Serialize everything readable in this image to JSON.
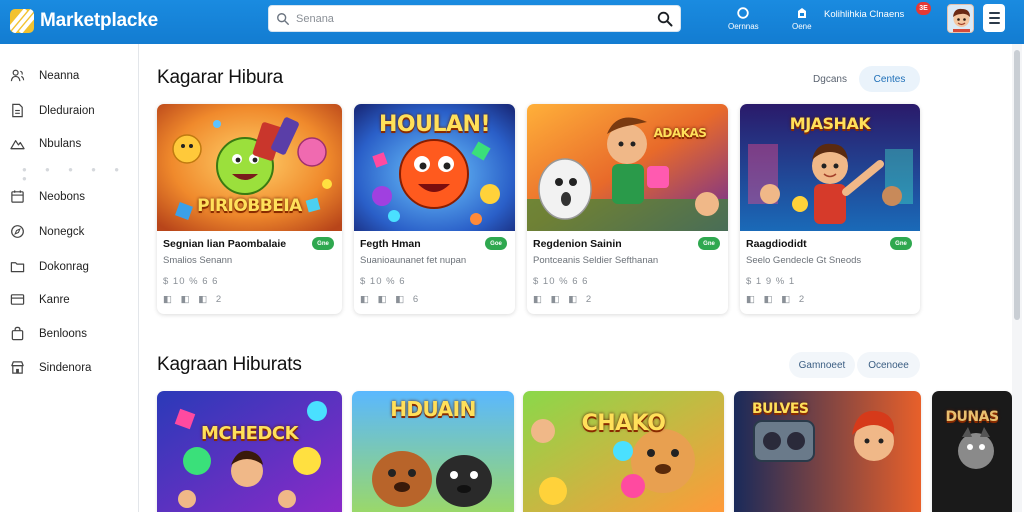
{
  "header": {
    "brand": "Marketplacke",
    "search": {
      "placeholder": "Senana",
      "value": ""
    },
    "actions": [
      {
        "label": "Oernnas",
        "icon": "circle-icon"
      },
      {
        "label": "Oene",
        "icon": "bag-icon"
      }
    ],
    "notification_text": "Kolihlihkia Clnaens",
    "notification_badge": "3E"
  },
  "sidebar": {
    "items": [
      {
        "label": "Neanna",
        "icon": "people-icon"
      },
      {
        "label": "Dleduraion",
        "icon": "document-icon"
      },
      {
        "label": "Nbulans",
        "icon": "mountain-icon"
      },
      {
        "label": "Neobons",
        "icon": "calendar-icon"
      },
      {
        "label": "Nonegck",
        "icon": "compass-icon"
      },
      {
        "label": "Dokonrag",
        "icon": "folder-icon"
      },
      {
        "label": "Kanre",
        "icon": "card-icon"
      },
      {
        "label": "Benloons",
        "icon": "bag-icon"
      },
      {
        "label": "Sindenora",
        "icon": "store-icon"
      }
    ]
  },
  "sections": [
    {
      "title": "Kagarar Hibura",
      "tabs": [
        {
          "label": "Dgcans",
          "active": false
        },
        {
          "label": "Centes",
          "active": true
        }
      ],
      "cards": [
        {
          "thumb_title": "PIRIOBBEIA",
          "name": "Segnian lian Paombalaie",
          "tag": "Gne",
          "subtitle": "Smalios Senann",
          "price": "$ 10 % 6 6",
          "icons": "◧ ◧ ◧ 2"
        },
        {
          "thumb_title": "HOULAN!",
          "name": "Fegth Hman",
          "tag": "Goe",
          "subtitle": "Suanioaunanet fet nupan",
          "price": "$ 10 % 6",
          "icons": "◧ ◧ ◧ 6"
        },
        {
          "thumb_title": "ADAKAS",
          "name": "Regdenion Sainin",
          "tag": "Gne",
          "subtitle": "Pontceanis Seldier Sefthanan",
          "price": "$ 10 % 6 6",
          "icons": "◧ ◧ ◧ 2"
        },
        {
          "thumb_title": "MJASHAK",
          "name": "Raagdiodidt",
          "tag": "Gne",
          "subtitle": "Seelo Gendecle Gt Sneods",
          "price": "$ 1 9 % 1",
          "icons": "◧ ◧ ◧ 2"
        }
      ]
    },
    {
      "title": "Kagraan Hiburats",
      "tabs": [
        {
          "label": "Gamnoeet",
          "active": false
        },
        {
          "label": "Ocenoee",
          "active": false
        }
      ],
      "cards": [
        {
          "thumb_title": "MCHEDCK"
        },
        {
          "thumb_title": "HDUAIN"
        },
        {
          "thumb_title": "CHAKO"
        },
        {
          "thumb_title": "BULVES"
        },
        {
          "thumb_title": "DUNAS"
        }
      ]
    }
  ],
  "colors": {
    "header_blue": "#1685da",
    "tag_green": "#2fa84f",
    "accent_blue": "#1e6fb8"
  }
}
